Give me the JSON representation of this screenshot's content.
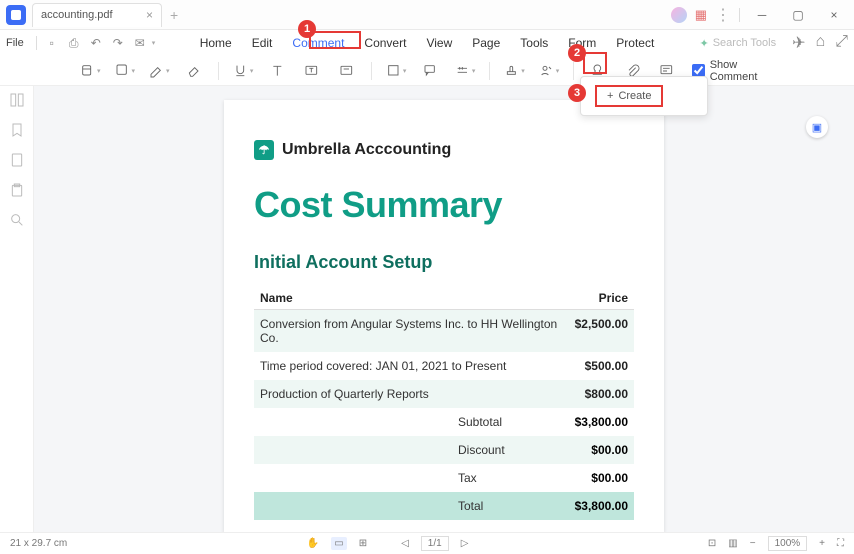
{
  "titlebar": {
    "tab_name": "accounting.pdf"
  },
  "file_menu": "File",
  "menus": [
    "Home",
    "Edit",
    "Comment",
    "Convert",
    "View",
    "Page",
    "Tools",
    "Form",
    "Protect"
  ],
  "active_menu": "Comment",
  "search_placeholder": "Search Tools",
  "show_comment_label": "Show Comment",
  "popup": {
    "create": "Create"
  },
  "doc": {
    "brand": "Umbrella Acccounting",
    "title": "Cost Summary",
    "section": "Initial Account Setup",
    "head_name": "Name",
    "head_price": "Price",
    "rows": [
      {
        "name": "Conversion from Angular Systems Inc. to HH Wellington Co.",
        "price": "$2,500.00"
      },
      {
        "name": "Time period covered: JAN 01, 2021 to Present",
        "price": "$500.00"
      },
      {
        "name": "Production of Quarterly Reports",
        "price": "$800.00"
      }
    ],
    "summary": [
      {
        "label": "Subtotal",
        "value": "$3,800.00",
        "cls": ""
      },
      {
        "label": "Discount",
        "value": "$00.00",
        "cls": "e"
      },
      {
        "label": "Tax",
        "value": "$00.00",
        "cls": ""
      },
      {
        "label": "Total",
        "value": "$3,800.00",
        "cls": "t"
      }
    ]
  },
  "status": {
    "dims": "21 x 29.7 cm",
    "page": "1/1",
    "zoom": "100%"
  },
  "badges": [
    "1",
    "2",
    "3"
  ]
}
